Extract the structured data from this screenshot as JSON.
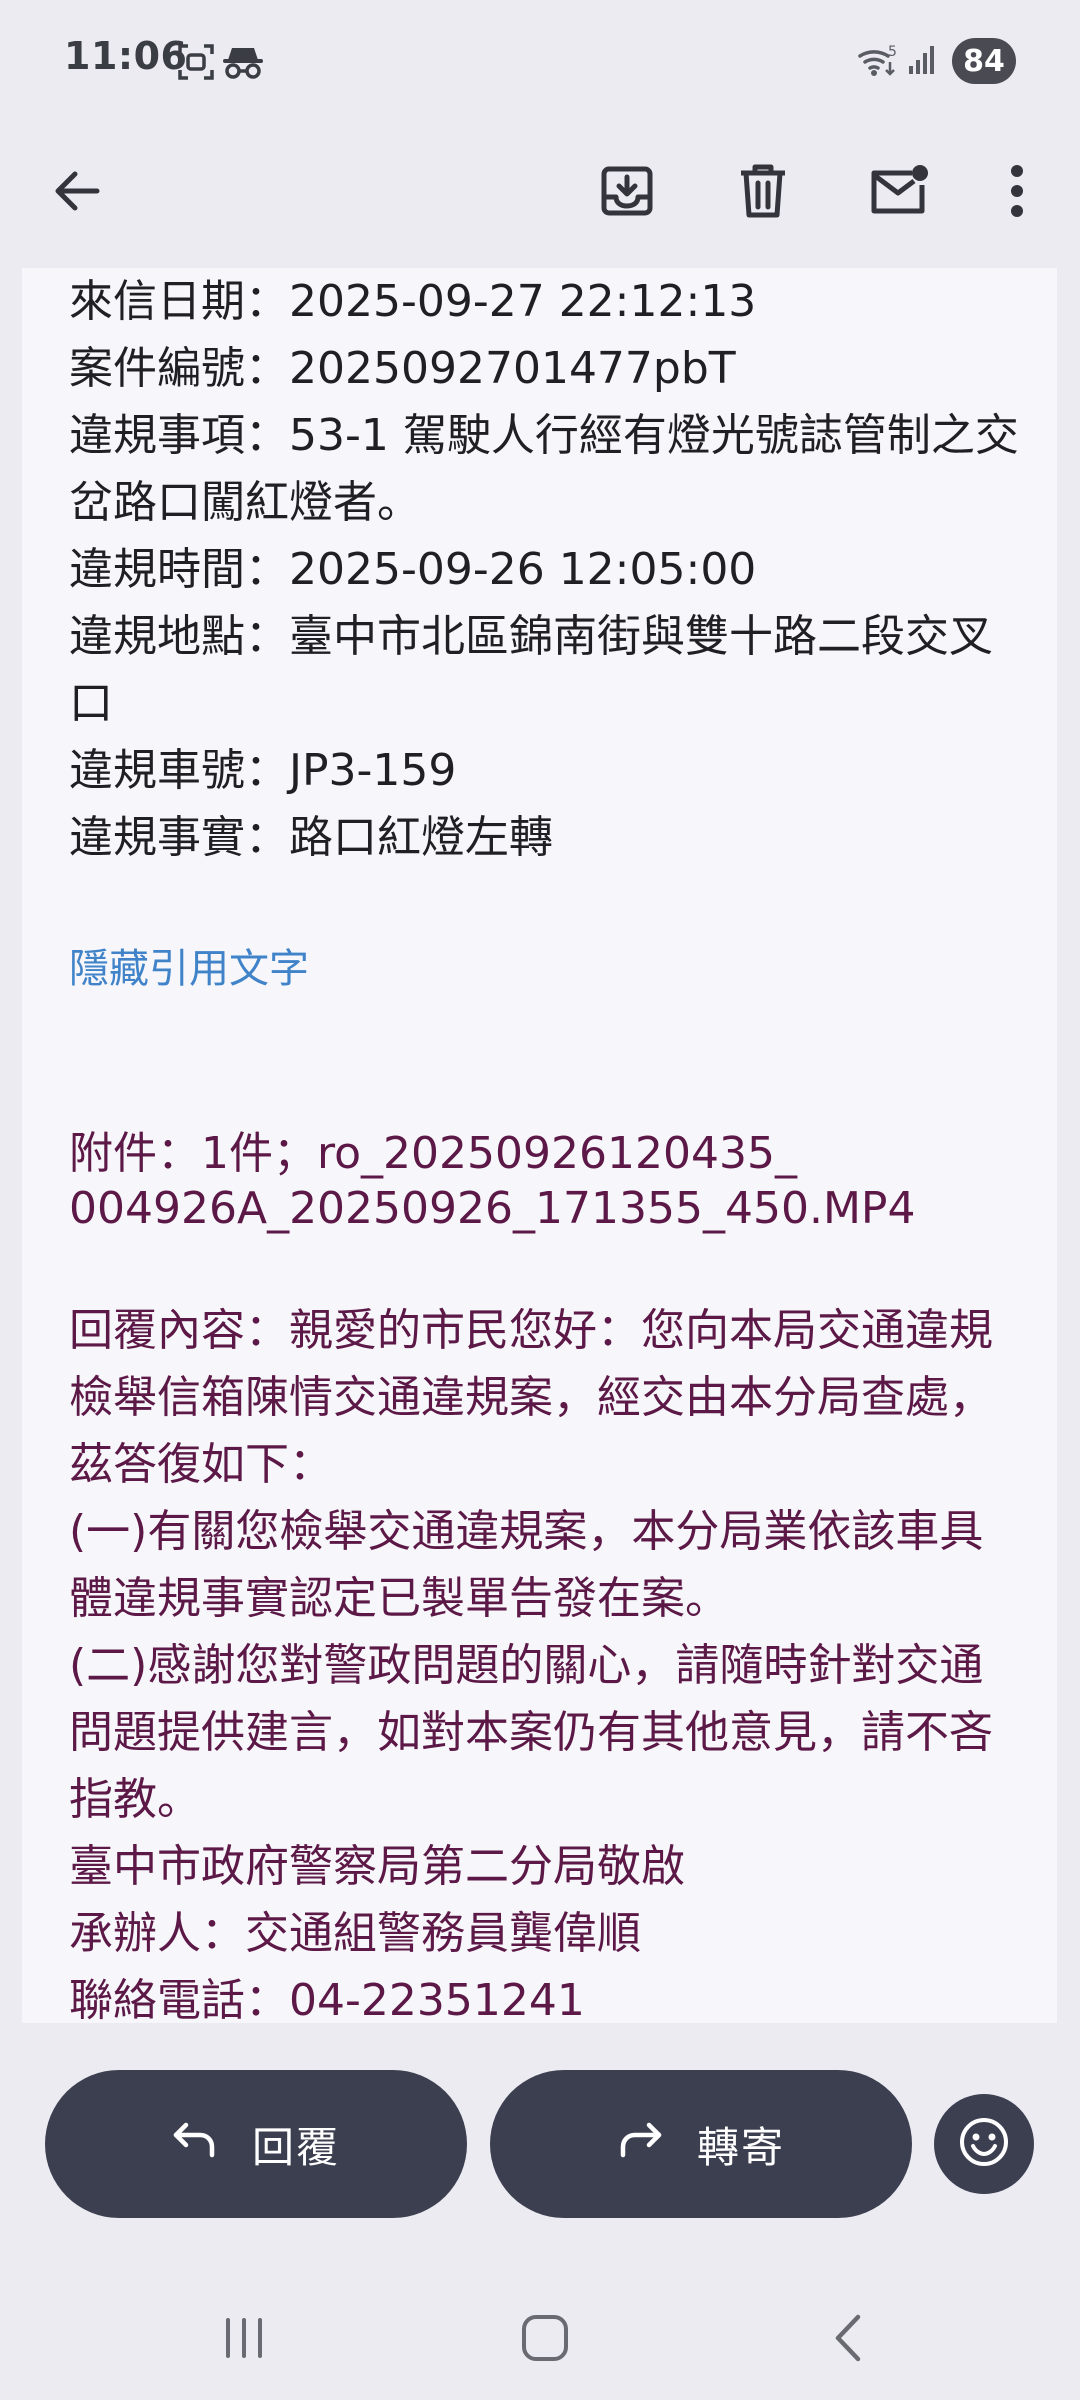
{
  "status_bar": {
    "time": "11:06",
    "battery": "84",
    "wifi_label": "5",
    "icons": [
      "screenshot-icon",
      "incognito-icon",
      "wifi-icon",
      "signal-icon"
    ]
  },
  "app_bar": {
    "icons": [
      "back-arrow-icon",
      "archive-icon",
      "delete-icon",
      "mark-unread-icon",
      "more-vert-icon"
    ]
  },
  "email": {
    "lines": [
      "來信日期：2025-09-27 22:12:13",
      "案件編號：2025092701477pbT",
      "違規事項：53-1 駕駛人行經有燈光號誌管制之交",
      "岔路口闖紅燈者。",
      "違規時間：2025-09-26 12:05:00",
      "違規地點：臺中市北區錦南街與雙十路二段交叉",
      "口",
      "違規車號：JP3-159",
      "違規事實：路口紅燈左轉"
    ],
    "hide_quoted_text": "隱藏引用文字",
    "attachment_lines": [
      "附件：1件；ro_20250926120435_",
      "004926A_20250926_171355_450.MP4"
    ],
    "reply_lines": [
      "回覆內容：親愛的市民您好：您向本局交通違規",
      "檢舉信箱陳情交通違規案，經交由本分局查處，",
      "茲答復如下：",
      "(一)有關您檢舉交通違規案，本分局業依該車具",
      "體違規事實認定已製單告發在案。",
      "(二)感謝您對警政問題的關心，請隨時針對交通",
      "問題提供建言，如對本案仍有其他意見，請不吝",
      "指教。",
      "臺中市政府警察局第二分局敬啟",
      "承辦人：交通組警務員龔偉順",
      "聯絡電話：04-22351241"
    ]
  },
  "actions": {
    "reply_label": "回覆",
    "forward_label": "轉寄"
  },
  "colors": {
    "background": "#ebebf1",
    "card": "#f7f7fb",
    "quoted_text": "#5c1846",
    "link": "#4183c8",
    "pill": "#3c3f50"
  }
}
